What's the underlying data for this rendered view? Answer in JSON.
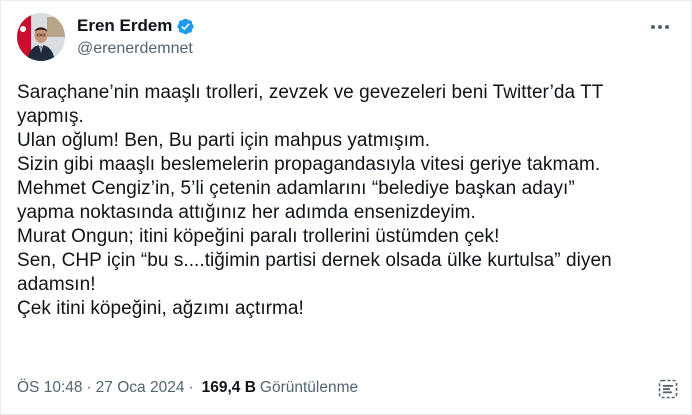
{
  "author": {
    "display_name": "Eren Erdem",
    "handle": "@erenerdemnet"
  },
  "tweet": {
    "text": "Saraçhane’nin maaşlı trolleri, zevzek ve gevezeleri beni Twitter’da TT\nyapmış.\nUlan oğlum! Ben, Bu parti için mahpus yatmışım.\nSizin gibi maaşlı beslemelerin propagandasıyla vitesi geriye takmam.\nMehmet Cengiz’in, 5’li çetenin adamlarını “belediye başkan adayı”\nyapma noktasında attığınız her adımda ensenizdeyim.\nMurat Ongun; itini köpeğini paralı trollerini üstümden çek!\nSen, CHP için “bu s....tiğimin partisi dernek olsada ülke kurtulsa” diyen\nadamsın!\nÇek itini köpeğini, ağzımı açtırma!"
  },
  "meta": {
    "time": "ÖS 10:48",
    "separator1": "·",
    "date": "27 Oca 2024",
    "separator2": "·",
    "views_count": "169,4 B",
    "views_label": "Görüntülenme"
  },
  "icons": {
    "verified": "verified-badge-icon",
    "more": "more-options-icon",
    "grok": "grok-icon"
  },
  "colors": {
    "verified": "#1d9bf0",
    "secondary_text": "#536471",
    "primary_text": "#0f1419"
  }
}
